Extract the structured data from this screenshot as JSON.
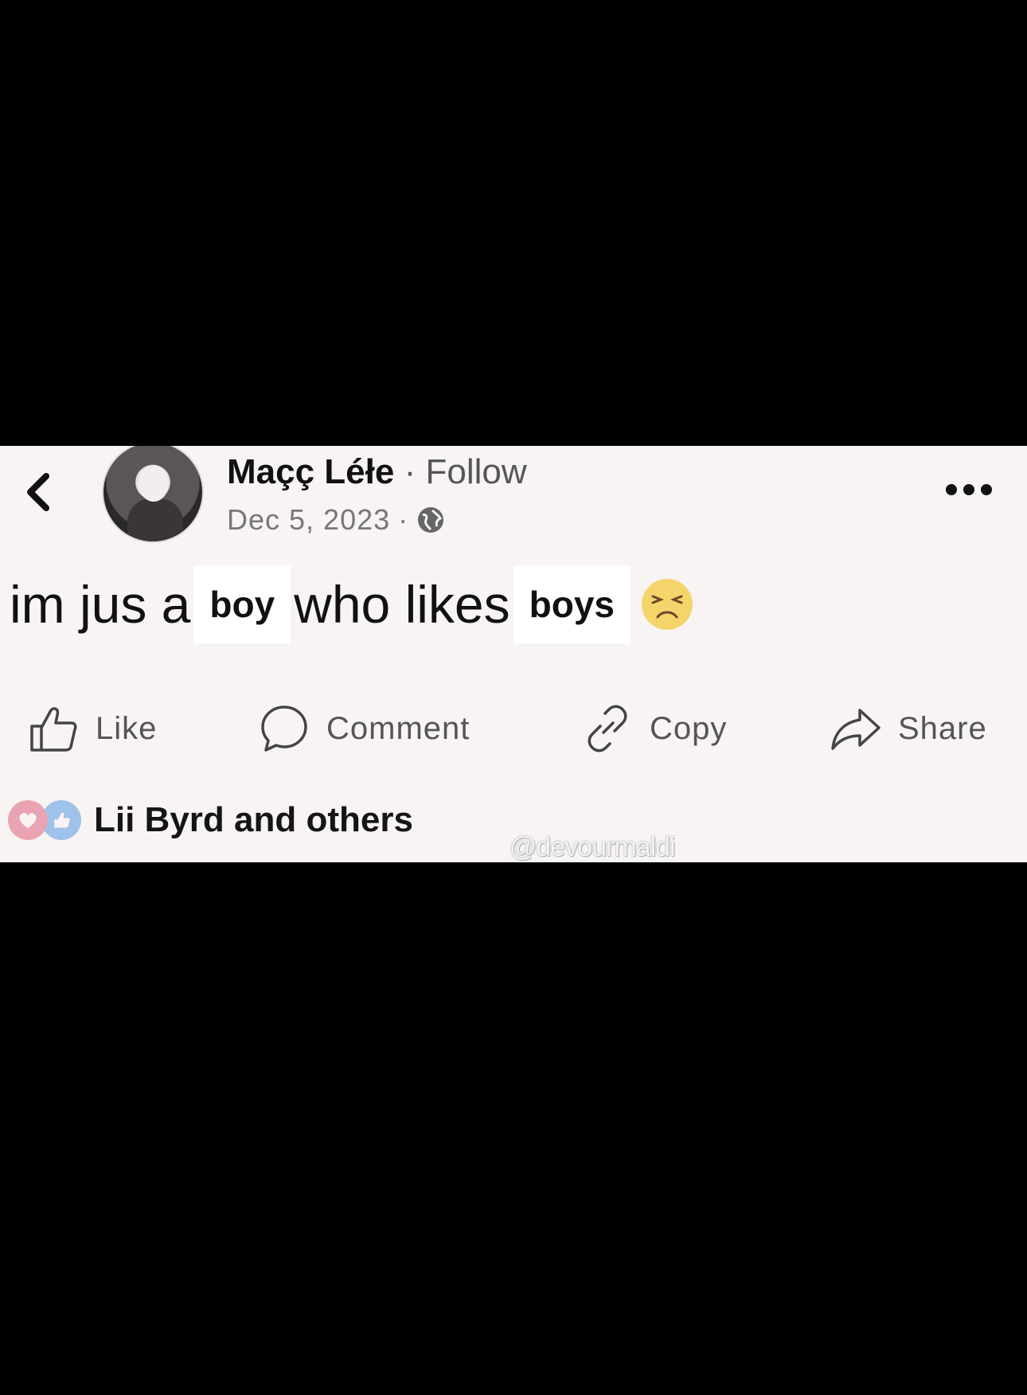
{
  "post": {
    "author": "Maçç Léłe",
    "separator": "·",
    "follow_label": "Follow",
    "date": "Dec 5, 2023",
    "date_separator": "·",
    "text": {
      "part1": "im jus a",
      "bold1": "boy",
      "part2": "who likes",
      "bold2": "boys"
    }
  },
  "actions": {
    "like": "Like",
    "comment": "Comment",
    "copy": "Copy",
    "share": "Share"
  },
  "reactions": {
    "summary": "Lii Byrd and others"
  },
  "watermark": "@devourmaldi",
  "icons": {
    "back": "chevron-left-icon",
    "privacy": "globe-icon",
    "more": "more-horizontal-icon",
    "emoji": "persevering-face-emoji",
    "like": "thumbs-up-icon",
    "comment": "comment-bubble-icon",
    "copy": "link-icon",
    "share": "share-arrow-icon",
    "reaction_love": "heart-reaction-icon",
    "reaction_like": "like-reaction-icon"
  },
  "colors": {
    "card_background": "#f8f4f4",
    "page_background": "#000000",
    "text_primary": "#111111",
    "text_secondary": "#555555",
    "love_reaction": "#e9a3b2",
    "like_reaction": "#9ec2ea"
  }
}
